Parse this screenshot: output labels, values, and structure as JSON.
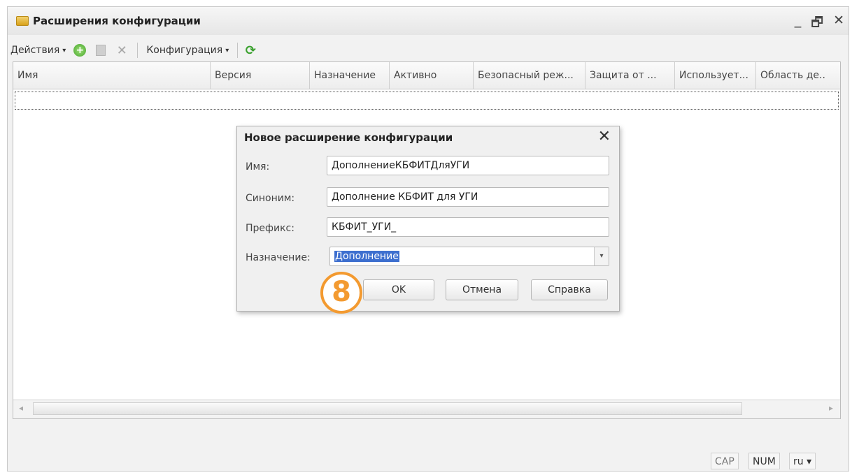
{
  "window": {
    "title": "Расширения конфигурации",
    "controls": {
      "minimize": "_",
      "restore": "🗗",
      "close": "✕"
    }
  },
  "toolbar": {
    "actions_label": "Действия",
    "configuration_label": "Конфигурация",
    "caret": "▾",
    "add_icon": "+",
    "delete_icon": "✕",
    "refresh_icon": "⟳"
  },
  "table": {
    "columns": [
      "Имя",
      "Версия",
      "Назначение",
      "Активно",
      "Безопасный реж...",
      "Защита от ...",
      "Использует...",
      "Область де..."
    ],
    "rows": []
  },
  "scroll": {
    "left": "◂",
    "right": "▸"
  },
  "dialog": {
    "title": "Новое расширение конфигурации",
    "close": "✕",
    "fields": {
      "name_label": "Имя:",
      "name_value": "ДополнениеКБФИТДляУГИ",
      "synonym_label": "Синоним:",
      "synonym_value": "Дополнение КБФИТ для УГИ",
      "prefix_label": "Префикс:",
      "prefix_value": "КБФИТ_УГИ_",
      "purpose_label": "Назначение:",
      "purpose_value": "Дополнение"
    },
    "buttons": {
      "ok": "OK",
      "cancel": "Отмена",
      "help": "Справка"
    },
    "dropdown_caret": "▾"
  },
  "annotation": {
    "step_number": "8"
  },
  "statusbar": {
    "cap": "CAP",
    "num": "NUM",
    "lang": "ru ▾"
  },
  "colors": {
    "accent_orange": "#f39a30",
    "selection_blue": "#3d6fcf"
  }
}
